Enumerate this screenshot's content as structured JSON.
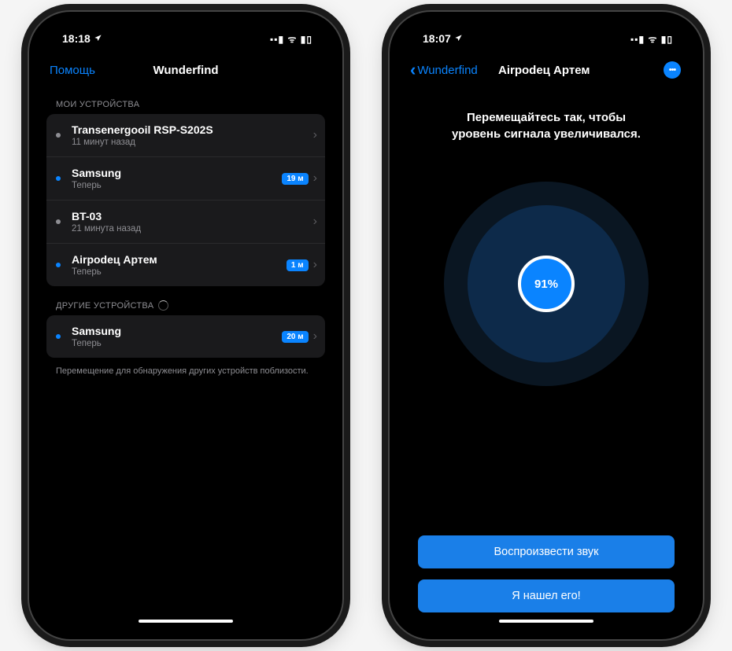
{
  "left": {
    "status": {
      "time": "18:18",
      "loc_icon": "location-arrow-icon",
      "indicators": "▪▪▮ ᯤ ▮▯"
    },
    "nav": {
      "help": "Помощь",
      "title": "Wunderfind"
    },
    "section_my": "МОИ УСТРОЙСТВА",
    "devices": [
      {
        "name": "Transenergooil RSP-S202S",
        "sub": "11 минут назад",
        "dot": "gray",
        "badge": ""
      },
      {
        "name": "Samsung",
        "sub": "Теперь",
        "dot": "blue",
        "badge": "19 м"
      },
      {
        "name": "BT-03",
        "sub": "21 минута назад",
        "dot": "gray",
        "badge": ""
      },
      {
        "name": "Airpodец Артем",
        "sub": "Теперь",
        "dot": "blue",
        "badge": "1 м"
      }
    ],
    "section_other": "ДРУГИЕ УСТРОЙСТВА",
    "other": [
      {
        "name": "Samsung",
        "sub": "Теперь",
        "dot": "blue",
        "badge": "20 м"
      }
    ],
    "hint": "Перемещение для обнаружения других устройств поблизости."
  },
  "right": {
    "status": {
      "time": "18:07",
      "loc_icon": "location-arrow-icon",
      "indicators": "▪▪▮ ᯤ ▮▯"
    },
    "nav": {
      "back": "Wunderfind",
      "title": "Airpodец Артем",
      "more": "•••"
    },
    "instruct_l1": "Перемещайтесь так, чтобы",
    "instruct_l2": "уровень сигнала увеличивался.",
    "signal": "91%",
    "btn_play": "Воспроизвести звук",
    "btn_found": "Я нашел его!"
  }
}
